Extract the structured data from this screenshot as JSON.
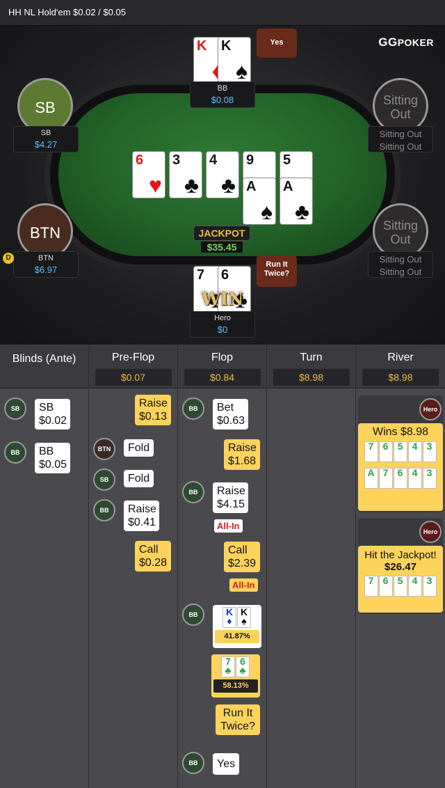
{
  "title": "HH NL Hold'em $0.02 / $0.05",
  "logo": {
    "prefix": "GG",
    "name": "POKER"
  },
  "seats": {
    "bb": {
      "name": "BB",
      "amount": "$0.08",
      "bubble": "Yes"
    },
    "sb": {
      "circle": "SB",
      "name": "SB",
      "amount": "$4.27"
    },
    "btn": {
      "circle": "BTN",
      "name": "BTN",
      "amount": "$6.97",
      "dealer": "D"
    },
    "hero": {
      "name": "Hero",
      "amount": "$0",
      "bubble": "Run It Twice?",
      "win": "WIN"
    },
    "right_top": {
      "circle": "Sitting Out",
      "name": "Sitting Out",
      "amount": "Sitting Out"
    },
    "right_bottom": {
      "circle": "Sitting Out",
      "name": "Sitting Out",
      "amount": "Sitting Out"
    }
  },
  "bb_cards": [
    {
      "rank": "K",
      "suit": "♦"
    },
    {
      "rank": "K",
      "suit": "♠"
    }
  ],
  "hero_cards": [
    {
      "rank": "7",
      "suit": "♣"
    },
    {
      "rank": "6",
      "suit": "♣"
    }
  ],
  "board1": [
    {
      "rank": "6",
      "suit": "♥"
    },
    {
      "rank": "3",
      "suit": "♣"
    },
    {
      "rank": "4",
      "suit": "♣"
    },
    {
      "rank": "9",
      "suit": "♣"
    },
    {
      "rank": "5",
      "suit": "♣"
    }
  ],
  "board2": [
    {
      "rank": "A",
      "suit": "♠"
    },
    {
      "rank": "A",
      "suit": "♣"
    }
  ],
  "jackpot": {
    "label": "JACKPOT",
    "amount": "$35.45"
  },
  "history": {
    "columns": [
      {
        "name": "Blinds (Ante)",
        "pot": ""
      },
      {
        "name": "Pre-Flop",
        "pot": "$0.07"
      },
      {
        "name": "Flop",
        "pot": "$0.84"
      },
      {
        "name": "Turn",
        "pot": "$8.98"
      },
      {
        "name": "River",
        "pot": "$8.98"
      }
    ],
    "blinds": [
      {
        "chip": "SB",
        "action": "SB",
        "amount": "$0.02"
      },
      {
        "chip": "BB",
        "action": "BB",
        "amount": "$0.05"
      }
    ],
    "preflop": [
      {
        "action": "Raise",
        "amount": "$0.13"
      },
      {
        "chip": "BTN",
        "action": "Fold"
      },
      {
        "chip": "SB",
        "action": "Fold"
      },
      {
        "chip": "BB",
        "action": "Raise",
        "amount": "$0.41"
      },
      {
        "action": "Call",
        "amount": "$0.28"
      }
    ],
    "flop": [
      {
        "chip": "BB",
        "action": "Bet",
        "amount": "$0.63"
      },
      {
        "action": "Raise",
        "amount": "$1.68"
      },
      {
        "chip": "BB",
        "action": "Raise",
        "amount": "$4.15",
        "tag": "All-In"
      },
      {
        "action": "Call",
        "amount": "$2.39",
        "tag": "All-In"
      },
      {
        "chip": "BB",
        "cards": [
          "K",
          "K"
        ],
        "equity": "41.87%"
      },
      {
        "cards": [
          "7",
          "6"
        ],
        "equity": "58.13%"
      },
      {
        "action": "Run It Twice?"
      },
      {
        "chip": "BB",
        "action": "Yes"
      }
    ],
    "river": [
      {
        "chip": "Hero",
        "title": "Wins $8.98",
        "row1": [
          "7",
          "6",
          "5",
          "4",
          "3"
        ],
        "row2": [
          "A",
          "7",
          "6",
          "4",
          "3"
        ]
      },
      {
        "chip": "Hero",
        "title": "Hit the Jackpot!",
        "amount": "$26.47",
        "row1": [
          "7",
          "6",
          "5",
          "4",
          "3"
        ]
      }
    ]
  }
}
